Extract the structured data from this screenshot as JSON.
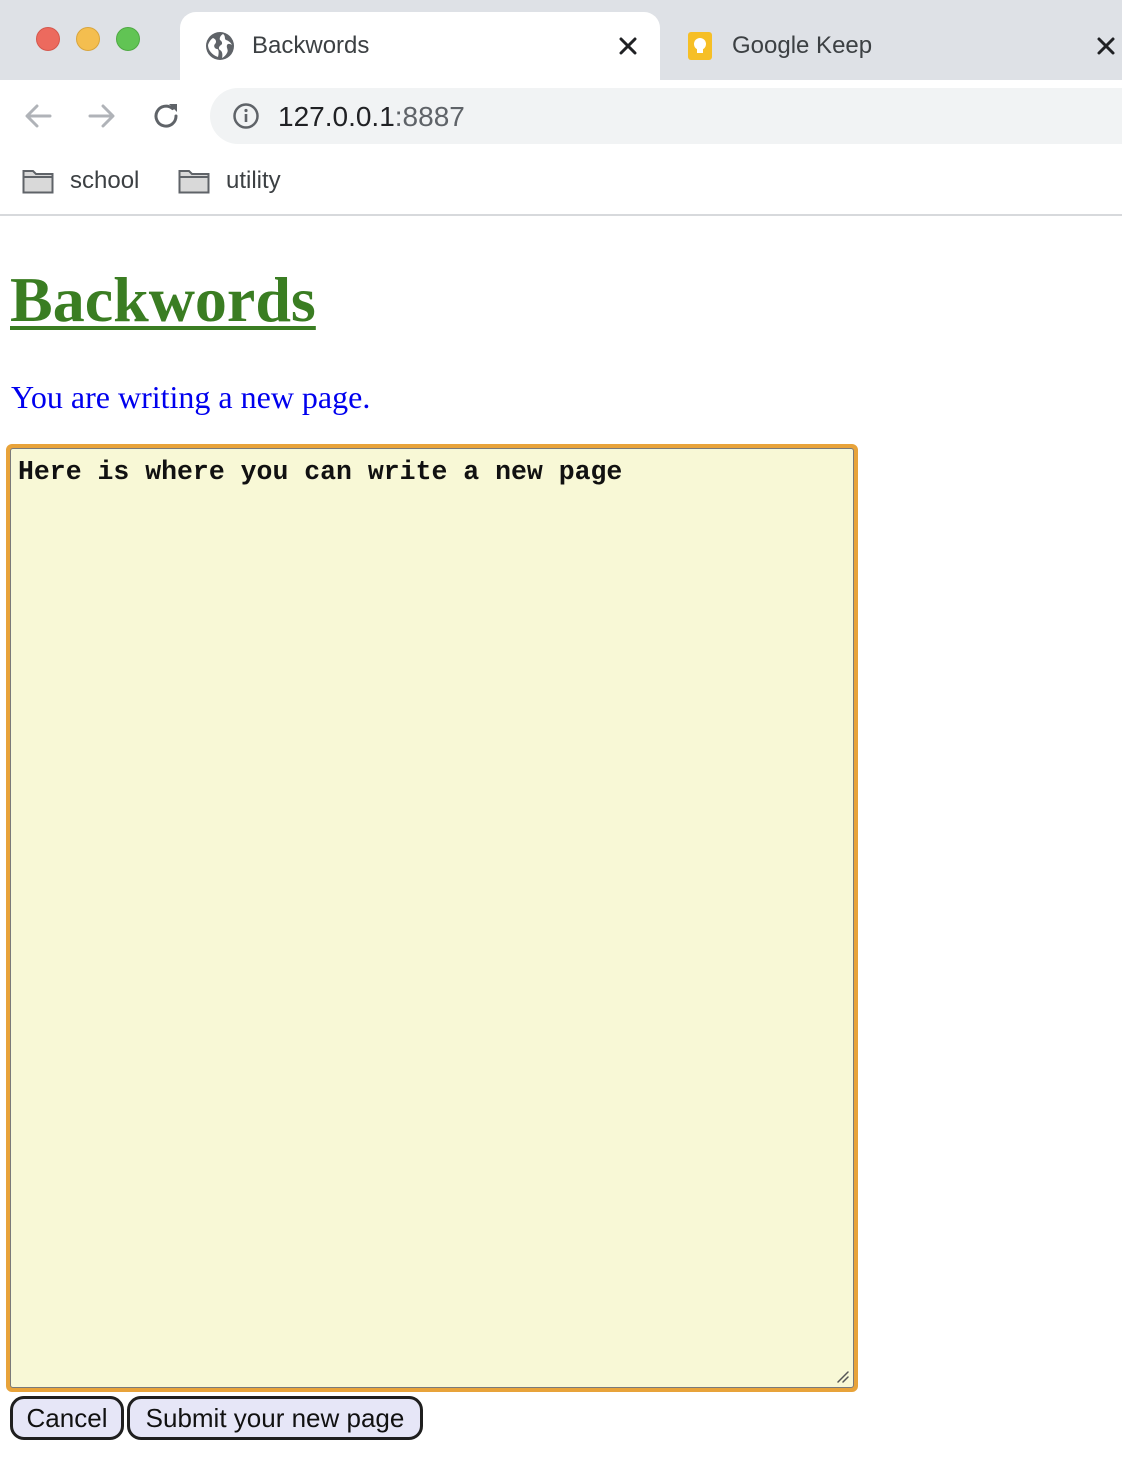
{
  "browser": {
    "tabs": [
      {
        "title": "Backwords",
        "icon": "globe-icon",
        "active": true
      },
      {
        "title": "Google Keep",
        "icon": "google-keep-icon",
        "active": false
      }
    ],
    "address": {
      "host": "127.0.0.1",
      "port": ":8887"
    },
    "bookmarks": [
      {
        "label": "school",
        "icon": "folder-icon"
      },
      {
        "label": "utility",
        "icon": "folder-icon"
      }
    ]
  },
  "page": {
    "title": "Backwords",
    "status": "You are writing a new page.",
    "editor_text": "Here is where you can write a new page",
    "buttons": {
      "cancel": "Cancel",
      "submit": "Submit your new page"
    }
  },
  "colors": {
    "title_green": "#3a7d22",
    "status_blue": "#0000ee",
    "editor_bg": "#f8f8d6",
    "focus_ring": "#e8a33a",
    "button_bg": "#e6e6f7"
  }
}
